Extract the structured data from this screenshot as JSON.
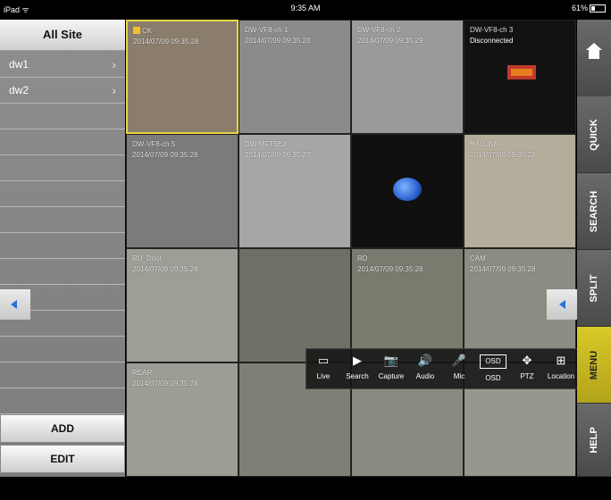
{
  "statusbar": {
    "left": "iPad ᯤ",
    "center": "9:35 AM",
    "right": "61%"
  },
  "sidebar": {
    "header": "All Site",
    "items": [
      {
        "label": "dw1"
      },
      {
        "label": "dw2"
      }
    ],
    "add_label": "ADD",
    "edit_label": "EDIT"
  },
  "grid": [
    {
      "title": "CK",
      "ts": "2014/07/09 09:35:28",
      "bg": "#8a7d6b",
      "selected": true
    },
    {
      "title": "DW-VF8-ch 1",
      "ts": "2014/07/09 09:35:28",
      "bg": "#8b8b8b"
    },
    {
      "title": "DW-VF8-ch 2",
      "ts": "2014/07/09 09:35:29",
      "bg": "#9a9a9a"
    },
    {
      "title": "DW-VF8-ch 3",
      "ts": "",
      "status": "Disconnected",
      "bg": "#121212",
      "logo": true
    },
    {
      "title": "DW-VF8-ch 5",
      "ts": "2014/07/09 09:35:28",
      "bg": "#7b7b7b"
    },
    {
      "title": "DW-MFT6EX",
      "ts": "2014/07/09 09:35:27",
      "bg": "#a6a6a6"
    },
    {
      "title": "",
      "ts": "",
      "bg": "#101010",
      "globe": true
    },
    {
      "title": "HALLWAY",
      "ts": "2014/07/09 09:35:28",
      "bg": "#b4ad9b"
    },
    {
      "title": "RD_Door",
      "ts": "2014/07/09 09:35:28",
      "bg": "#9c9f95"
    },
    {
      "title": "",
      "ts": "",
      "bg": "#6f6f66"
    },
    {
      "title": "RD",
      "ts": "2014/07/09 09:35:28",
      "bg": "#7a7a6e"
    },
    {
      "title": "CAM",
      "ts": "2014/07/09 09:35:28",
      "bg": "#8c8c82"
    },
    {
      "title": "REAR",
      "ts": "2014/07/09 09:35:28",
      "bg": "#9d9d95"
    },
    {
      "title": "",
      "ts": "",
      "bg": "#7f7f76"
    },
    {
      "title": "",
      "ts": "",
      "bg": "#8a8a80"
    },
    {
      "title": "",
      "ts": "",
      "bg": "#98978d"
    }
  ],
  "toolbar": {
    "items": [
      {
        "label": "Live",
        "icon": "▭",
        "name": "live-icon"
      },
      {
        "label": "Search",
        "icon": "▶",
        "name": "search-play-icon"
      },
      {
        "label": "Capture",
        "icon": "📷",
        "name": "camera-icon"
      },
      {
        "label": "Audio",
        "icon": "🔊",
        "name": "audio-icon"
      },
      {
        "label": "Mic",
        "icon": "🎤",
        "name": "mic-icon"
      },
      {
        "label": "OSD",
        "icon": "OSD",
        "name": "osd-icon"
      },
      {
        "label": "PTZ",
        "icon": "✥",
        "name": "ptz-icon"
      },
      {
        "label": "Location",
        "icon": "⊞",
        "name": "location-icon"
      }
    ]
  },
  "rightmenu": {
    "items": [
      {
        "label": "QUICK"
      },
      {
        "label": "SEARCH"
      },
      {
        "label": "SPLIT"
      },
      {
        "label": "MENU",
        "active": true
      },
      {
        "label": "HELP"
      }
    ]
  }
}
